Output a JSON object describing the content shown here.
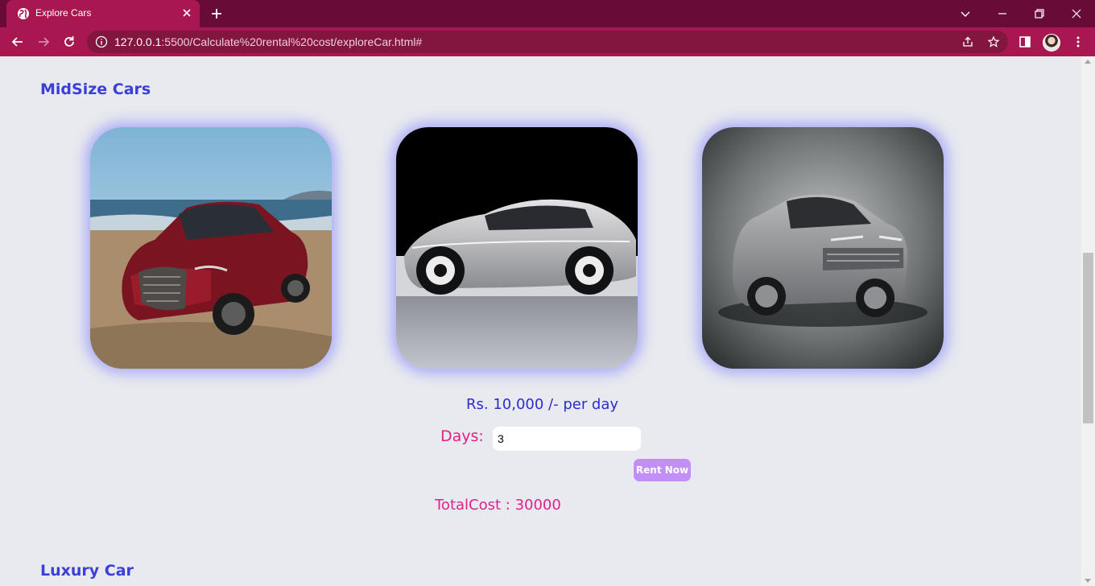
{
  "browser": {
    "tab_title": "Explore Cars",
    "url_host": "127.0.0.1",
    "url_rest": ":5500/Calculate%20rental%20cost/exploreCar.html#"
  },
  "page": {
    "midsize_title": "MidSize Cars",
    "price_text": "Rs. 10,000 /- per day",
    "days_label": "Days:",
    "days_value": "3",
    "rent_button": "Rent Now",
    "total_text": "TotalCost : 30000",
    "luxury_title": "Luxury Car",
    "cars": [
      {
        "name": "red-sedan-beach"
      },
      {
        "name": "silver-concept-sedan"
      },
      {
        "name": "silver-suv"
      }
    ]
  },
  "colors": {
    "chrome_dark": "#680c37",
    "chrome_tab": "#a8174f",
    "heading": "#3b3fd6",
    "accent_pink": "#e0218a",
    "button": "#c28ff7"
  }
}
